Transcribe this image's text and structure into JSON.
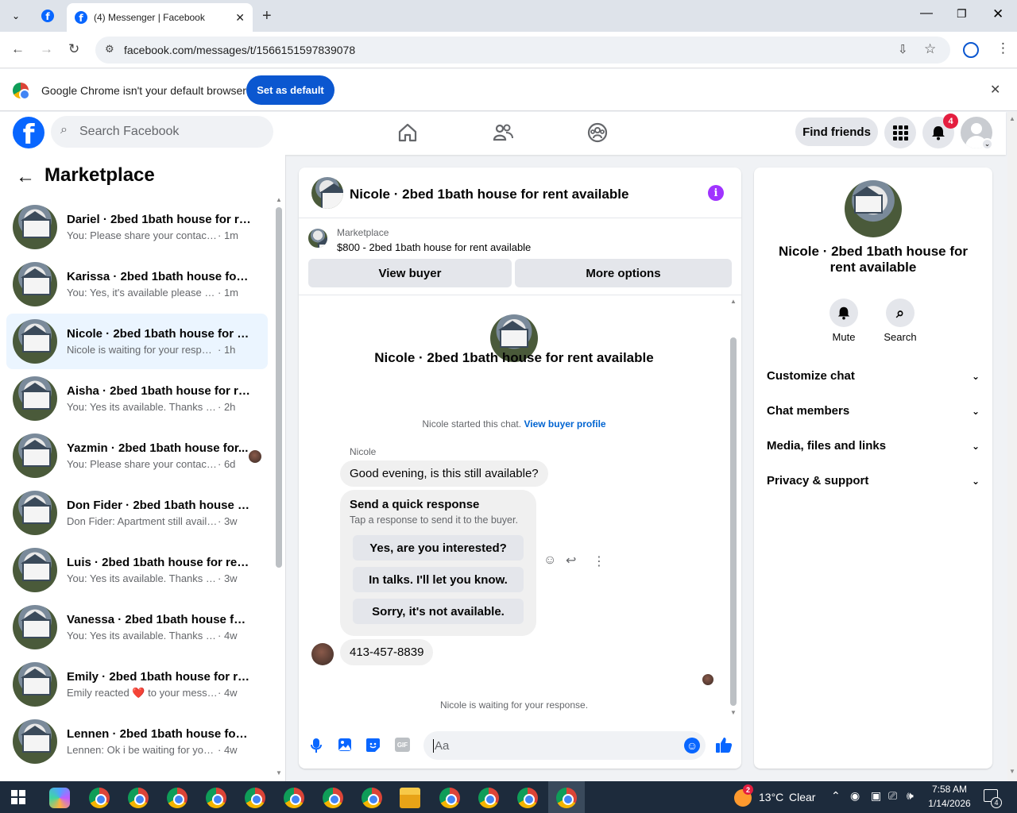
{
  "browser": {
    "tab_title": "(4) Messenger | Facebook",
    "url": "facebook.com/messages/t/1566151597839078",
    "infobar_text": "Google Chrome isn't your default browser",
    "set_default_label": "Set as default"
  },
  "fb_header": {
    "search_placeholder": "Search Facebook",
    "find_friends_label": "Find friends",
    "notification_count": "4"
  },
  "left_panel": {
    "title": "Marketplace",
    "conversations": [
      {
        "name": "Dariel · 2bed 1bath house for re...",
        "message": "You: Please share your contact nu...",
        "time": " · 1m"
      },
      {
        "name": "Karissa · 2bed 1bath house for re...",
        "message": "You: Yes, it's available please drop ...",
        "time": " · 1m"
      },
      {
        "name": "Nicole · 2bed 1bath house for re...",
        "message": "Nicole is waiting for your response.",
        "time": " · 1h"
      },
      {
        "name": "Aisha · 2bed 1bath house for ren...",
        "message": "You: Yes its available. Thanks for rea...",
        "time": " · 2h"
      },
      {
        "name": "Yazmin · 2bed 1bath house for...",
        "message": "You: Please share your contact n...",
        "time": " · 6d"
      },
      {
        "name": "Don Fider · 2bed 1bath house fo...",
        "message": "Don Fider: Apartment still available?",
        "time": " · 3w"
      },
      {
        "name": "Luis · 2bed 1bath house for rent ...",
        "message": "You: Yes its available. Thanks for re...",
        "time": " · 3w"
      },
      {
        "name": "Vanessa · 2bed 1bath house for r...",
        "message": "You: Yes its available. Thanks for re...",
        "time": " · 4w"
      },
      {
        "name": "Emily · 2bed 1bath house for ren...",
        "message": "Emily reacted ❤️ to your message",
        "time": " · 4w"
      },
      {
        "name": "Lennen · 2bed 1bath house for r...",
        "message": "Lennen: Ok i be waiting for your ca...",
        "time": " · 4w"
      }
    ]
  },
  "chat": {
    "header_title": "Nicole · 2bed 1bath house for rent available",
    "listing_source": "Marketplace",
    "listing_title": "$800 - 2bed 1bath house for rent available",
    "view_buyer_label": "View buyer",
    "more_options_label": "More options",
    "intro_title": "Nicole · 2bed 1bath house for rent available",
    "started_text": "Nicole started this chat.",
    "view_buyer_profile": "View buyer profile",
    "sender_name": "Nicole",
    "message_1": "Good evening, is this still available?",
    "quick_response_title": "Send a quick response",
    "quick_response_sub": "Tap a response to send it to the buyer.",
    "quick_responses": [
      "Yes, are you interested?",
      "In talks. I'll let you know.",
      "Sorry, it's not available."
    ],
    "message_2": "413-457-8839",
    "waiting_text": "Nicole is waiting for your response.",
    "input_placeholder": "Aa"
  },
  "right_panel": {
    "title": "Nicole · 2bed 1bath house for rent available",
    "mute_label": "Mute",
    "search_label": "Search",
    "sections": [
      "Customize chat",
      "Chat members",
      "Media, files and links",
      "Privacy & support"
    ]
  },
  "taskbar": {
    "temperature": "13°C",
    "weather": "Clear",
    "time": "7:58 AM",
    "date": "1/14/2026",
    "notif_count": "4",
    "weather_badge": "2"
  }
}
